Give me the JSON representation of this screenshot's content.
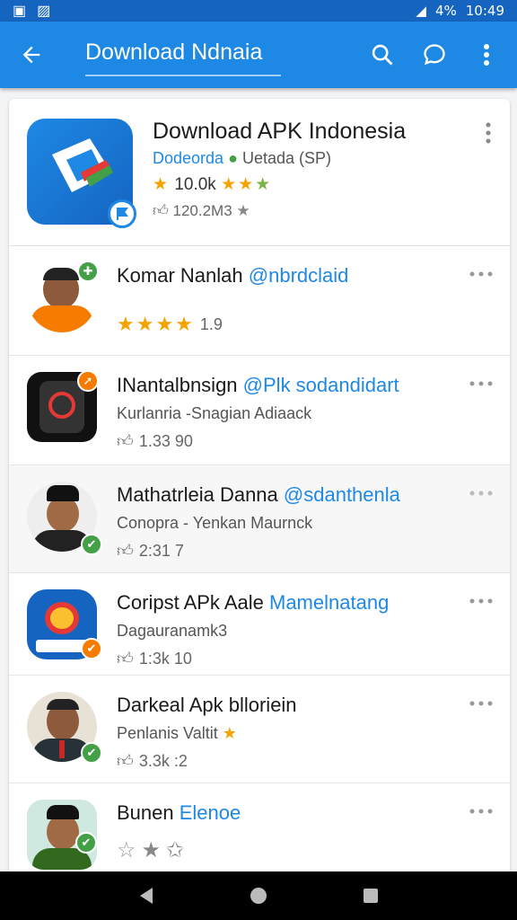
{
  "status_bar": {
    "battery": "4%",
    "time": "10:49"
  },
  "app_bar": {
    "title": "Download Ndnaia"
  },
  "header": {
    "title": "Download APK Indonesia",
    "publisher": "Dodeorda",
    "version": "Uetada (SP)",
    "rating_text": "10.0k",
    "likes": "120.2M3"
  },
  "rows": [
    {
      "name": "Komar Nanlah",
      "handle": "@nbrdclaid",
      "subtitle": "",
      "meta": "1.9",
      "meta_type": "stars",
      "stars": 4
    },
    {
      "name": "INantalbnsign",
      "handle": "@Plk sodandidart",
      "subtitle": "Kurlanria -Snagian Adiaack",
      "meta": "1.33 90",
      "meta_type": "likes"
    },
    {
      "name": "Mathatrleia Danna",
      "handle": "@sdanthenla",
      "subtitle": "Conopra - Yenkan Maurnck",
      "meta": "2:31 7",
      "meta_type": "likes"
    },
    {
      "name": "Coripst APk Aale",
      "handle": "Mamelnatang",
      "subtitle": "Dagauranamk3",
      "meta": "1:3k 10",
      "meta_type": "likes"
    },
    {
      "name": "Darkeal Apk blloriein",
      "handle": "",
      "subtitle": "Penlanis Valtit",
      "meta": "3.3k :2",
      "meta_type": "likes"
    },
    {
      "name": "Bunen",
      "handle": "Elenoe",
      "subtitle": "",
      "meta": "",
      "meta_type": "stars-outline"
    }
  ],
  "colors": {
    "primary": "#1e88e5",
    "star": "#f4a300",
    "badge_green": "#43a047",
    "badge_orange": "#f57c00"
  }
}
